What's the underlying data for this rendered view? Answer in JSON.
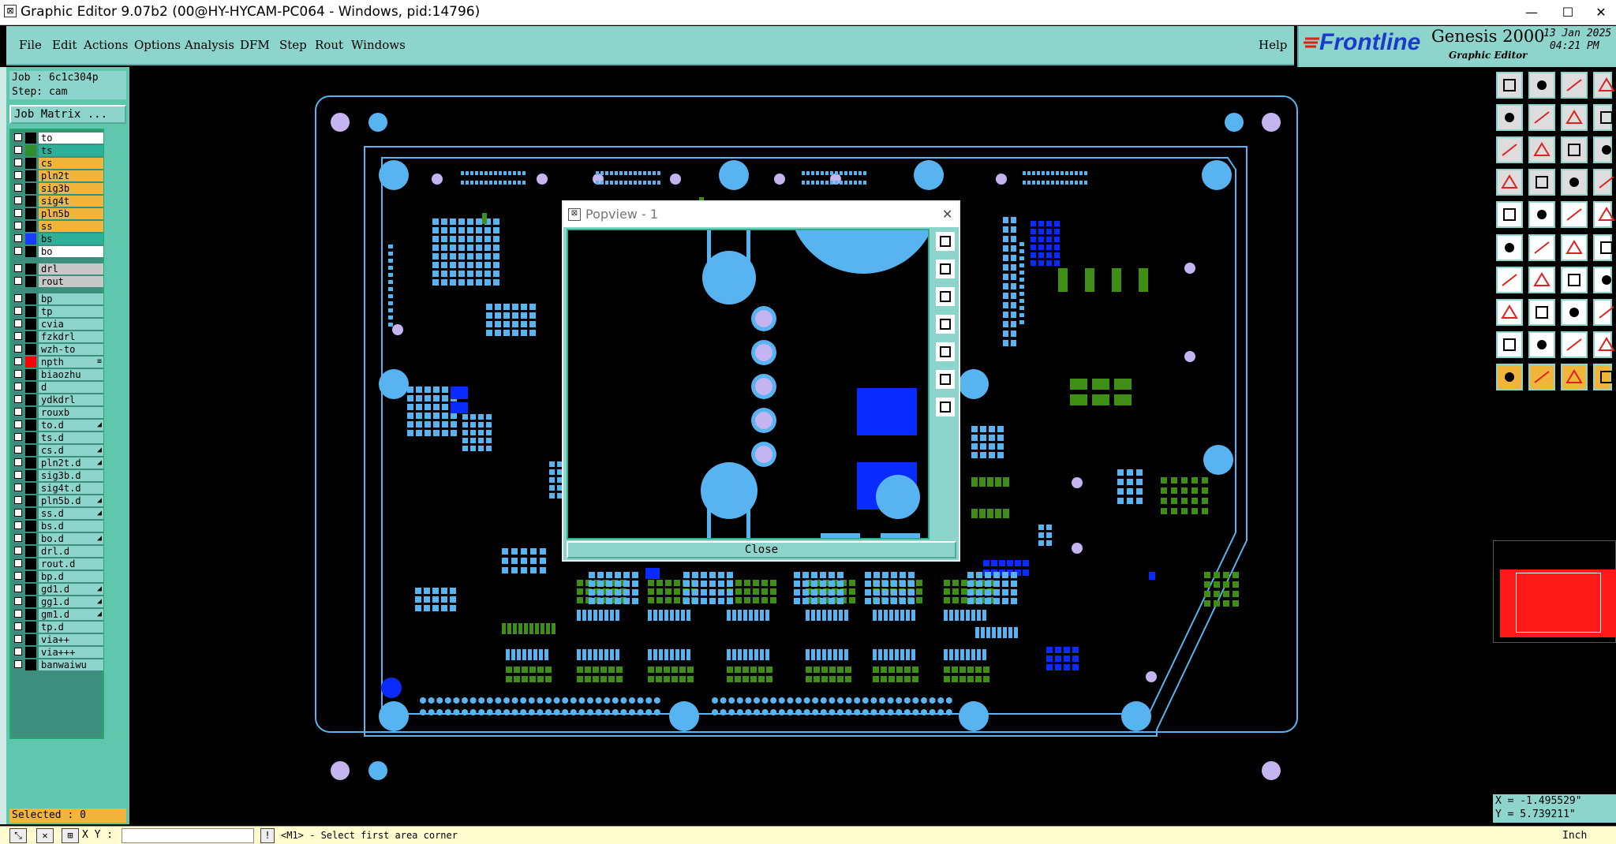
{
  "window": {
    "title": "Graphic Editor 9.07b2 (00@HY-HYCAM-PC064 - Windows, pid:14796)",
    "minimize": "—",
    "maximize": "☐",
    "close": "✕"
  },
  "menu": {
    "items": [
      "File",
      "Edit",
      "Actions",
      "Options",
      "Analysis",
      "DFM",
      "Step",
      "Rout",
      "Windows"
    ],
    "help": "Help"
  },
  "brand": {
    "logo": "Frontline",
    "product": "Genesis 2000",
    "subtitle": "Graphic Editor",
    "date": "13 Jan 2025",
    "time": "04:21 PM"
  },
  "job": {
    "job_line": "Job : 6c1c304p",
    "step_line": "Step: cam",
    "matrix_button": "Job Matrix ..."
  },
  "layers": [
    {
      "name": "to",
      "color": "#ffffff",
      "swatch": "#000000"
    },
    {
      "name": "ts",
      "color": "#2db09a",
      "swatch": "#2f8f2f"
    },
    {
      "name": "cs",
      "color": "#f0b53a",
      "swatch": "#000000"
    },
    {
      "name": "pln2t",
      "color": "#f0b53a",
      "swatch": "#000000"
    },
    {
      "name": "sig3b",
      "color": "#f0b53a",
      "swatch": "#000000"
    },
    {
      "name": "sig4t",
      "color": "#f0b53a",
      "swatch": "#000000"
    },
    {
      "name": "pln5b",
      "color": "#f0b53a",
      "swatch": "#000000"
    },
    {
      "name": "ss",
      "color": "#f0b53a",
      "swatch": "#000000"
    },
    {
      "name": "bs",
      "color": "#2db09a",
      "swatch": "#1a3cff"
    },
    {
      "name": "bo",
      "color": "#ffffff",
      "swatch": "#000000"
    },
    {
      "name": "drl",
      "color": "#c8c8c8",
      "swatch": "#000000"
    },
    {
      "name": "rout",
      "color": "#c8c8c8",
      "swatch": "#000000"
    },
    {
      "name": "bp",
      "color": "#8cd4cc",
      "swatch": "#000000"
    },
    {
      "name": "tp",
      "color": "#8cd4cc",
      "swatch": "#000000"
    },
    {
      "name": "cvia",
      "color": "#8cd4cc",
      "swatch": "#000000"
    },
    {
      "name": "fzkdrl",
      "color": "#8cd4cc",
      "swatch": "#000000"
    },
    {
      "name": "wzh-to",
      "color": "#8cd4cc",
      "swatch": "#000000"
    },
    {
      "name": "npth",
      "color": "#8cd4cc",
      "swatch": "#ff0000",
      "mark": "≡"
    },
    {
      "name": "biaozhu",
      "color": "#8cd4cc",
      "swatch": "#000000"
    },
    {
      "name": "d",
      "color": "#8cd4cc",
      "swatch": "#000000"
    },
    {
      "name": "ydkdrl",
      "color": "#8cd4cc",
      "swatch": "#000000"
    },
    {
      "name": "rouxb",
      "color": "#8cd4cc",
      "swatch": "#000000"
    },
    {
      "name": "to.d",
      "color": "#8cd4cc",
      "swatch": "#000000",
      "mark": "◢"
    },
    {
      "name": "ts.d",
      "color": "#8cd4cc",
      "swatch": "#000000"
    },
    {
      "name": "cs.d",
      "color": "#8cd4cc",
      "swatch": "#000000",
      "mark": "◢"
    },
    {
      "name": "pln2t.d",
      "color": "#8cd4cc",
      "swatch": "#000000",
      "mark": "◢"
    },
    {
      "name": "sig3b.d",
      "color": "#8cd4cc",
      "swatch": "#000000"
    },
    {
      "name": "sig4t.d",
      "color": "#8cd4cc",
      "swatch": "#000000"
    },
    {
      "name": "pln5b.d",
      "color": "#8cd4cc",
      "swatch": "#000000",
      "mark": "◢"
    },
    {
      "name": "ss.d",
      "color": "#8cd4cc",
      "swatch": "#000000",
      "mark": "◢"
    },
    {
      "name": "bs.d",
      "color": "#8cd4cc",
      "swatch": "#000000"
    },
    {
      "name": "bo.d",
      "color": "#8cd4cc",
      "swatch": "#000000",
      "mark": "◢"
    },
    {
      "name": "drl.d",
      "color": "#8cd4cc",
      "swatch": "#000000"
    },
    {
      "name": "rout.d",
      "color": "#8cd4cc",
      "swatch": "#000000"
    },
    {
      "name": "bp.d",
      "color": "#8cd4cc",
      "swatch": "#000000"
    },
    {
      "name": "gd1.d",
      "color": "#8cd4cc",
      "swatch": "#000000",
      "mark": "◢"
    },
    {
      "name": "gg1.d",
      "color": "#8cd4cc",
      "swatch": "#000000",
      "mark": "◢"
    },
    {
      "name": "gm1.d",
      "color": "#8cd4cc",
      "swatch": "#000000",
      "mark": "◢"
    },
    {
      "name": "tp.d",
      "color": "#8cd4cc",
      "swatch": "#000000"
    },
    {
      "name": "via++",
      "color": "#8cd4cc",
      "swatch": "#000000"
    },
    {
      "name": "via+++",
      "color": "#8cd4cc",
      "swatch": "#000000"
    },
    {
      "name": "banwaiwu",
      "color": "#8cd4cc",
      "swatch": "#000000"
    }
  ],
  "status": {
    "selected": "Selected : 0",
    "xy_label": "X Y :",
    "xy_value": "",
    "prompt": "<M1> - Select first area corner",
    "unit": "Inch"
  },
  "coords": {
    "x": "X = -1.495529\"",
    "y": "Y = 5.739211\""
  },
  "popup": {
    "title": "Popview - 1",
    "close_label": "Close"
  },
  "colors": {
    "panel": "#8cd4cc",
    "panel_dark": "#5fc7ae",
    "pad": "#58b4f0",
    "green": "#3f8f16",
    "blue": "#0a2bff",
    "via": "#c4b4f0"
  }
}
